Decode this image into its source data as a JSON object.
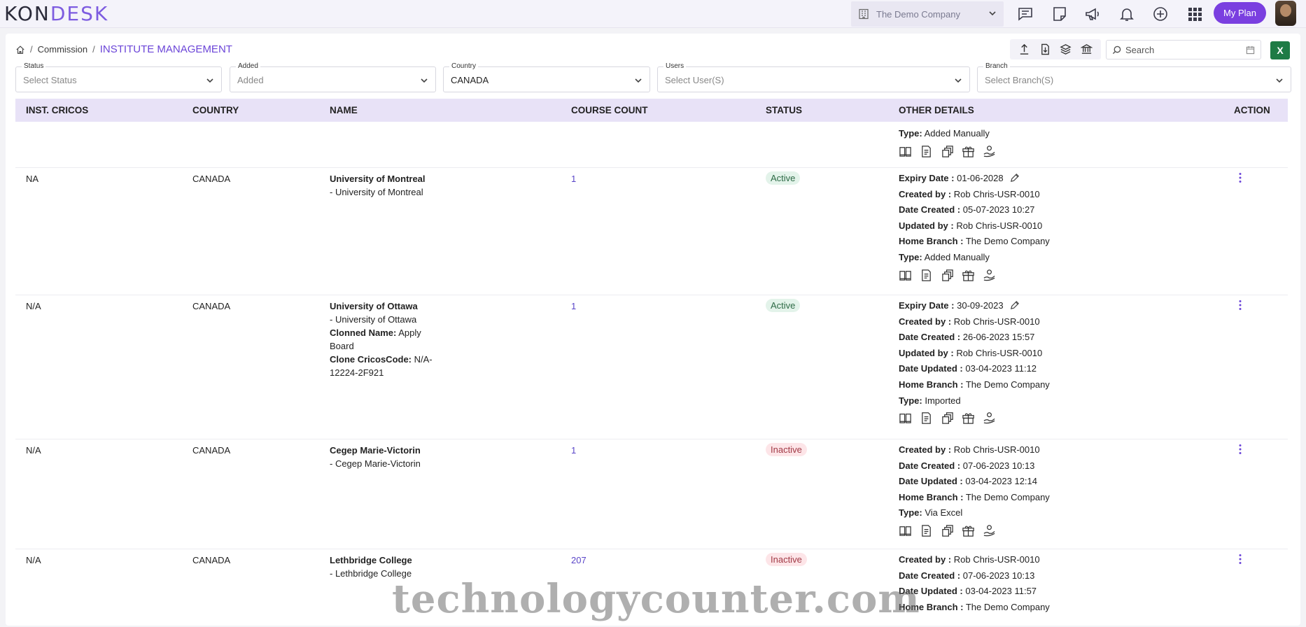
{
  "logo": {
    "part1": "KON",
    "part2": "DESK"
  },
  "topbar": {
    "company": "The Demo Company",
    "my_plan": "My Plan",
    "icons": [
      "chat-icon",
      "note-icon",
      "megaphone-icon",
      "bell-icon",
      "plus-circle-icon",
      "apps-grid-icon"
    ]
  },
  "breadcrumb": {
    "section": "Commission",
    "current": "INSTITUTE MANAGEMENT"
  },
  "toolbar": {
    "icons": [
      "upload-icon",
      "import-file-icon",
      "layers-icon",
      "bank-icon"
    ],
    "search_placeholder": "Search",
    "excel_label": "X"
  },
  "filters": [
    {
      "label": "Status",
      "value": "Select Status",
      "selected": false
    },
    {
      "label": "Added",
      "value": "Added",
      "selected": false
    },
    {
      "label": "Country",
      "value": "CANADA",
      "selected": true
    },
    {
      "label": "Users",
      "value": "Select User(S)",
      "selected": false
    },
    {
      "label": "Branch",
      "value": "Select Branch(S)",
      "selected": false
    }
  ],
  "table": {
    "columns": [
      "INST. CRICOS",
      "COUNTRY",
      "NAME",
      "COURSE COUNT",
      "STATUS",
      "OTHER DETAILS",
      "ACTION"
    ],
    "partial_row": {
      "type_label": "Type:",
      "type_value": "Added Manually"
    },
    "rows": [
      {
        "cricos": "NA",
        "country": "CANADA",
        "name": "University of Montreal",
        "sub": "- University of Montreal",
        "count": "1",
        "status": "Active",
        "details": [
          {
            "label": "Expiry Date :",
            "value": "01-06-2028"
          },
          {
            "label": "Created by :",
            "value": "Rob Chris-USR-0010"
          },
          {
            "label": "Date Created :",
            "value": "05-07-2023 10:27"
          },
          {
            "label": "Updated by :",
            "value": "Rob Chris-USR-0010"
          },
          {
            "label": "Home Branch :",
            "value": "The Demo Company"
          },
          {
            "label": "Type:",
            "value": "Added Manually"
          }
        ]
      },
      {
        "cricos": "N/A",
        "country": "CANADA",
        "name": "University of Ottawa",
        "sub": "- University of Ottawa",
        "clone_name_label": "Clonned Name:",
        "clone_name": "Apply Board",
        "clone_code_label": "Clone CricosCode:",
        "clone_code": "N/A-12224-2F921",
        "count": "1",
        "status": "Active",
        "details": [
          {
            "label": "Expiry Date :",
            "value": "30-09-2023"
          },
          {
            "label": "Created by :",
            "value": "Rob Chris-USR-0010"
          },
          {
            "label": "Date Created :",
            "value": "26-06-2023 15:57"
          },
          {
            "label": "Updated by :",
            "value": "Rob Chris-USR-0010"
          },
          {
            "label": "Date Updated :",
            "value": "03-04-2023 11:12"
          },
          {
            "label": "Home Branch :",
            "value": "The Demo Company"
          },
          {
            "label": "Type:",
            "value": "Imported"
          }
        ]
      },
      {
        "cricos": "N/A",
        "country": "CANADA",
        "name": "Cegep Marie-Victorin",
        "sub": "- Cegep Marie-Victorin",
        "count": "1",
        "status": "Inactive",
        "details": [
          {
            "label": "Created by :",
            "value": "Rob Chris-USR-0010"
          },
          {
            "label": "Date Created :",
            "value": "07-06-2023 10:13"
          },
          {
            "label": "Date Updated :",
            "value": "03-04-2023 12:14"
          },
          {
            "label": "Home Branch :",
            "value": "The Demo Company"
          },
          {
            "label": "Type:",
            "value": "Via Excel"
          }
        ]
      },
      {
        "cricos": "N/A",
        "country": "CANADA",
        "name": "Lethbridge College",
        "sub": "- Lethbridge College",
        "count": "207",
        "status": "Inactive",
        "details": [
          {
            "label": "Created by :",
            "value": "Rob Chris-USR-0010"
          },
          {
            "label": "Date Created :",
            "value": "07-06-2023 10:13"
          },
          {
            "label": "Date Updated :",
            "value": "03-04-2023 11:57"
          },
          {
            "label": "Home Branch :",
            "value": "The Demo Company"
          }
        ]
      }
    ],
    "row_icons": [
      "book-icon",
      "document-icon",
      "stack-icon",
      "gift-icon",
      "hand-coin-icon"
    ]
  },
  "watermark": "technologycounter.com"
}
